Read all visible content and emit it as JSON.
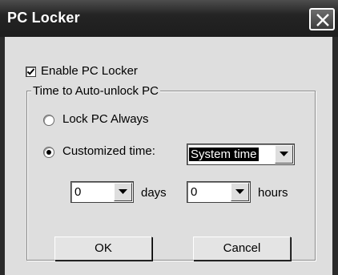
{
  "window": {
    "title": "PC Locker"
  },
  "enable": {
    "label": "Enable PC Locker",
    "checked": true
  },
  "group": {
    "title": "Time to Auto-unlock PC"
  },
  "options": {
    "lock_always": {
      "label": "Lock PC Always",
      "selected": false
    },
    "customized": {
      "label": "Customized time:",
      "selected": true
    }
  },
  "time_source": {
    "value": "System time"
  },
  "days": {
    "value": "0",
    "unit": "days"
  },
  "hours": {
    "value": "0",
    "unit": "hours"
  },
  "buttons": {
    "ok": "OK",
    "cancel": "Cancel"
  }
}
